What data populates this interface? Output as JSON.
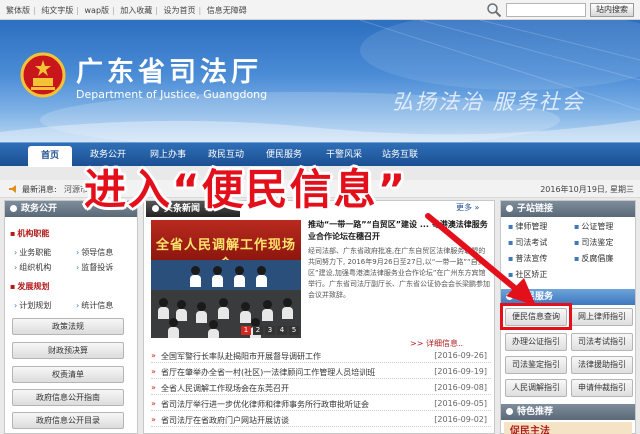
{
  "topbar": {
    "links": [
      "繁体版",
      "纯文字版",
      "wap版",
      "加入收藏",
      "设为首页",
      "信息无障碍"
    ],
    "search_placeholder": "",
    "search_button": "站内搜索"
  },
  "banner": {
    "title": "广东省司法厅",
    "subtitle": "Department of Justice, Guangdong",
    "slogan": "弘扬法治  服务社会"
  },
  "nav": {
    "items": [
      "首页",
      "政务公开",
      "网上办事",
      "政民互动",
      "便民服务",
      "干警风采",
      "站务互联"
    ]
  },
  "overlay": {
    "text": "进入“便民信息”"
  },
  "ticker": {
    "label": "最新消息:",
    "text": "河源市律",
    "date": "2016年10月19日, 星期三"
  },
  "left": {
    "header": "政务公开",
    "section1": {
      "title": "机构职能",
      "items": [
        "业务职能",
        "领导信息",
        "组织机构",
        "监督投诉"
      ]
    },
    "section2": {
      "title": "发展规划",
      "items": [
        "计划规划",
        "统计信息"
      ]
    },
    "buttons": [
      "政策法规",
      "财政预决算",
      "权责清单",
      "政府信息公开指南",
      "政府信息公开目录"
    ]
  },
  "center": {
    "tab": "头条新闻",
    "more": "更多 »",
    "photo_banner": "全省人民调解工作现场会",
    "pager": [
      "1",
      "2",
      "3",
      "4",
      "5"
    ],
    "headline": "推动“一带一路”“自贸区”建设 ... 粤港澳法律服务业合作论坛在穗召开",
    "summary": "经司法部、广东省政府批准,在广东自贸区法律服务联盟的共同努力下, 2016年9月26日至27日,以“一带一路”“自贸区”建设,加强粤港澳法律服务业合作论坛”在广州东方宾馆举行。广东省司法厅副厅长、广东省公证协会会长梁鹏参加会议并致辞。",
    "detail_link": ">> 详细信息..",
    "news": [
      {
        "title": "全国军警行长率队赴揭阳市开展督导调研工作",
        "date": "[2016-09-26]"
      },
      {
        "title": "省厅在肇举办全省一村(社区)一法律顾问工作管理人员培训班",
        "date": "[2016-09-19]"
      },
      {
        "title": "全省人民调解工作现场会在东莞召开",
        "date": "[2016-09-08]"
      },
      {
        "title": "省司法厅举行进一步优化律师和律师事务所行政审批听证会",
        "date": "[2016-09-05]"
      },
      {
        "title": "省司法厅在省政府门户网站开展访谈",
        "date": "[2016-09-02]"
      }
    ]
  },
  "right": {
    "sub_header": "子站链接",
    "sub_items": [
      "律师管理",
      "公证管理",
      "司法考试",
      "司法鉴定",
      "普法宣传",
      "反腐倡廉",
      "社区矫正"
    ],
    "svc_header": "便民服务",
    "svc_buttons": [
      "便民信息查询",
      "网上律师指引",
      "办理公证指引",
      "司法考试指引",
      "司法鉴定指引",
      "法律援助指引",
      "人民调解指引",
      "申请仲裁指引"
    ],
    "feature_header": "特色推荐",
    "promo": "促民主法"
  },
  "colors": {
    "nav_blue": "#1b4f92",
    "accent_red": "#e3101c"
  }
}
